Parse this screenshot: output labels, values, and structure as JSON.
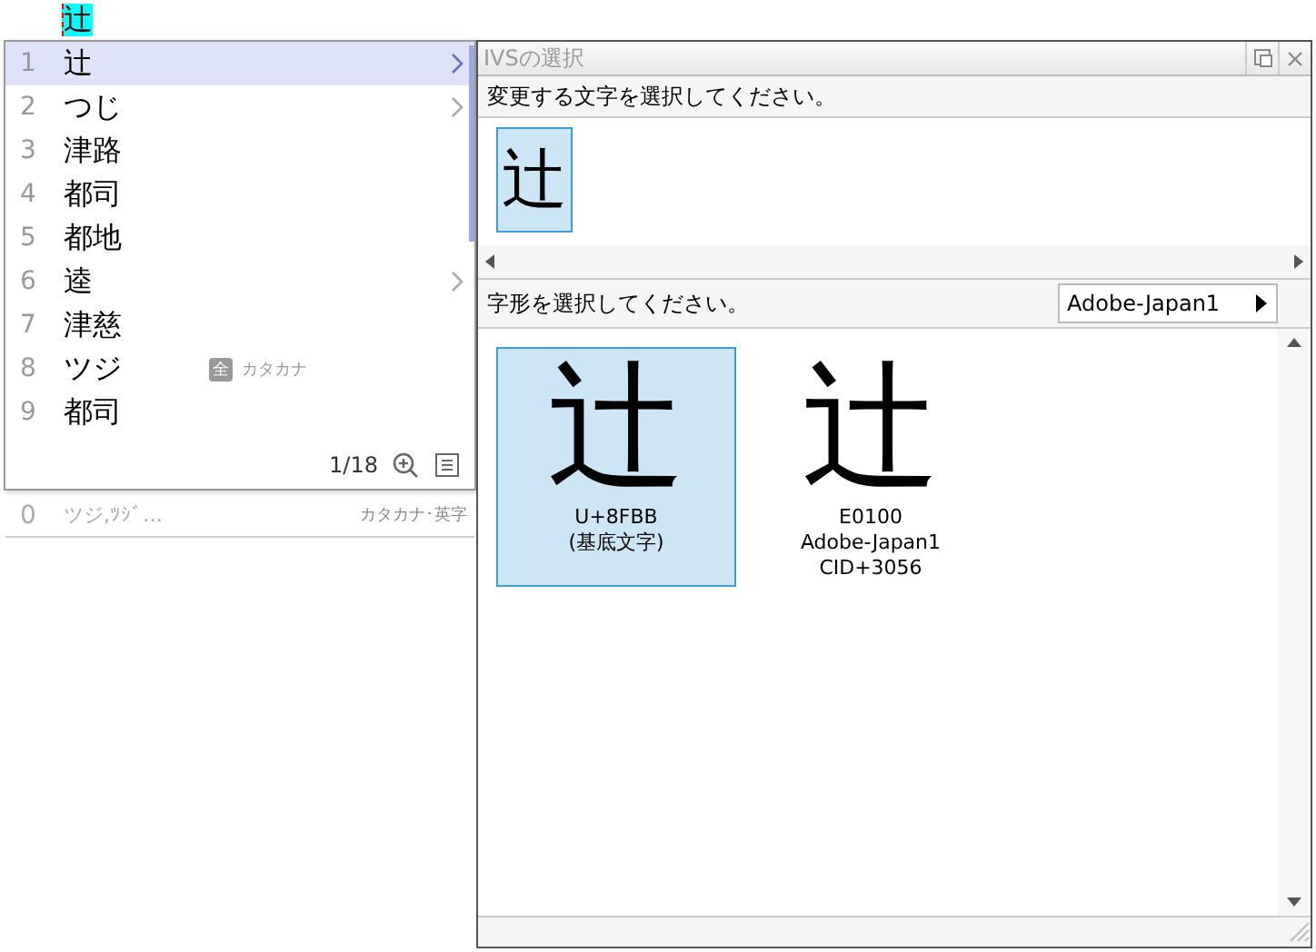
{
  "composition": {
    "text": "辻"
  },
  "candidates": [
    {
      "number": "1",
      "text": "辻",
      "selected": true,
      "submenu": true
    },
    {
      "number": "2",
      "text": "つじ",
      "selected": false,
      "submenu": true
    },
    {
      "number": "3",
      "text": "津路",
      "selected": false,
      "submenu": false
    },
    {
      "number": "4",
      "text": "都司",
      "selected": false,
      "submenu": false
    },
    {
      "number": "5",
      "text": "都地",
      "selected": false,
      "submenu": false
    },
    {
      "number": "6",
      "text": "逵",
      "selected": false,
      "submenu": true
    },
    {
      "number": "7",
      "text": "津慈",
      "selected": false,
      "submenu": false
    },
    {
      "number": "8",
      "text": "ツジ",
      "selected": false,
      "submenu": false,
      "badge": "全",
      "annotation": "カタカナ"
    },
    {
      "number": "9",
      "text": "都司",
      "selected": false,
      "submenu": false
    }
  ],
  "page_indicator": "1/18",
  "extra_row": {
    "number": "0",
    "text": "ツジ,ﾂｼﾞ…",
    "annotation": "カタカナ･英字"
  },
  "ivs_window": {
    "title": "IVSの選択",
    "prompt_char": "変更する文字を選択してください。",
    "base_chars": [
      {
        "char": "辻",
        "selected": true
      }
    ],
    "prompt_glyph": "字形を選択してください。",
    "collection": "Adobe-Japan1",
    "glyphs": [
      {
        "char": "辻",
        "lines": [
          "U+8FBB",
          "(基底文字)"
        ],
        "selected": true
      },
      {
        "char": "辻",
        "lines": [
          "E0100",
          "Adobe-Japan1",
          "CID+3056"
        ],
        "selected": false
      }
    ]
  }
}
